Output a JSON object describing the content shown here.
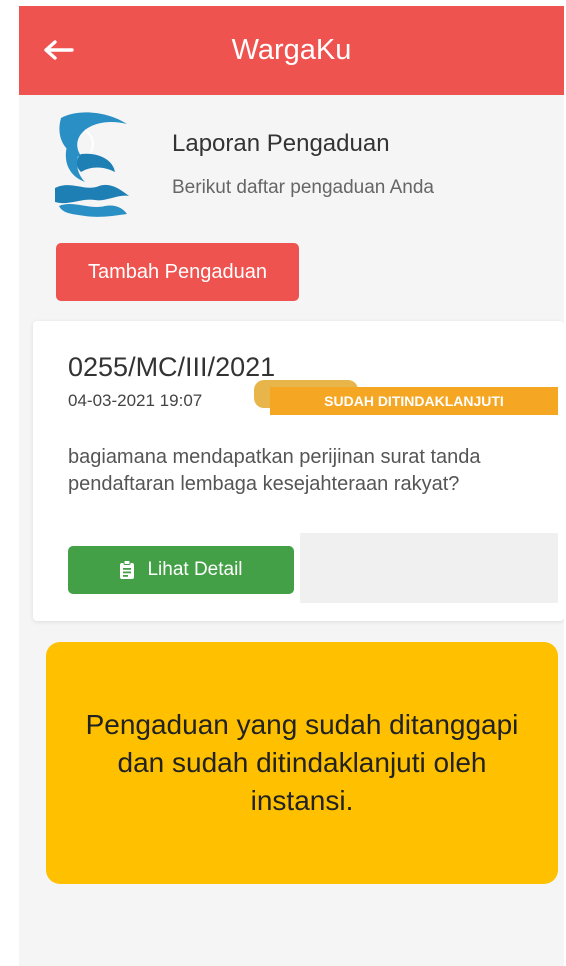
{
  "app": {
    "title": "WargaKu"
  },
  "header": {
    "title": "Laporan Pengaduan",
    "subtitle": "Berikut daftar pengaduan Anda"
  },
  "actions": {
    "add_label": "Tambah Pengaduan"
  },
  "report": {
    "id": "0255/MC/III/2021",
    "date": "04-03-2021 19:07",
    "status": "SUDAH DITINDAKLANJUTI",
    "description": "bagiamana mendapatkan perijinan surat tanda pendaftaran lembaga kesejahteraan rakyat?",
    "detail_label": "Lihat Detail"
  },
  "info": {
    "text": "Pengaduan yang sudah ditanggapi dan sudah ditindaklanjuti oleh instansi."
  },
  "icons": {
    "back": "back-arrow-icon",
    "logo": "dolphin-logo-icon",
    "detail": "clipboard-icon"
  },
  "colors": {
    "appbar": "#ef5350",
    "add_button": "#ef5350",
    "status": "#f5a623",
    "detail_button": "#43a047",
    "info_box": "#ffc000"
  }
}
